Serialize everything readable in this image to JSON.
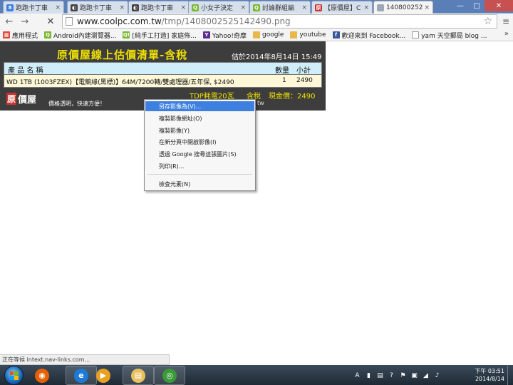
{
  "tabs": [
    {
      "label": "跑跑卡丁車",
      "favicon": "badge-8-icon",
      "color": "#3d7edb",
      "glyph": "8",
      "active": false
    },
    {
      "label": "跑跑卡丁車",
      "favicon": "gamer-icon",
      "color": "#444444",
      "glyph": "◐",
      "active": false
    },
    {
      "label": "跑跑卡丁車",
      "favicon": "gamer-icon",
      "color": "#444444",
      "glyph": "◐",
      "active": false
    },
    {
      "label": "小女子決定",
      "favicon": "q-icon",
      "color": "#7ab832",
      "glyph": "Q",
      "active": false
    },
    {
      "label": "討論群組編",
      "favicon": "q-icon",
      "color": "#7ab832",
      "glyph": "Q",
      "active": false
    },
    {
      "label": "【原價屋】C",
      "favicon": "coolpc-icon",
      "color": "#c8322f",
      "glyph": "原",
      "active": false
    },
    {
      "label": "140800252",
      "favicon": "page-icon",
      "color": "#9aa8b8",
      "glyph": "",
      "active": true
    }
  ],
  "window": {
    "minimize": "—",
    "maximize": "□",
    "close": "✕"
  },
  "toolbar": {
    "back": "←",
    "reload": "✕",
    "forward": "→"
  },
  "address": {
    "host": "www.coolpc.com.tw",
    "path": "/tmp/1408002525142490.png"
  },
  "bookmarks": [
    {
      "label": "應用程式",
      "icon": "apps-grid-icon",
      "color": "#e04a3a",
      "glyph": "▦"
    },
    {
      "label": "Android內建瀏覽器...",
      "icon": "q-icon",
      "color": "#7ab832",
      "glyph": "Q"
    },
    {
      "label": "[純手工打造] 家庭佈...",
      "icon": "q-icon",
      "color": "#7ab832",
      "glyph": "Q!"
    },
    {
      "label": "Yahoo!奇摩",
      "icon": "yahoo-icon",
      "color": "#5b2e91",
      "glyph": "Y"
    },
    {
      "label": "google",
      "icon": "folder-icon",
      "color": "#e8b84a",
      "glyph": ""
    },
    {
      "label": "youtube",
      "icon": "folder-icon",
      "color": "#e8b84a",
      "glyph": ""
    },
    {
      "label": "歡迎來到 Facebook...",
      "icon": "facebook-icon",
      "color": "#3b5998",
      "glyph": "f"
    },
    {
      "label": "yam 天空郵局 blog ...",
      "icon": "page-icon",
      "color": "#ffffff",
      "glyph": ""
    }
  ],
  "bookmarks_more": "»",
  "quote": {
    "title": "原價屋線上估價清單-含稅",
    "date": "估於2014年8月14日 15:49",
    "header": {
      "name": "產 品 名 稱",
      "qty": "數量",
      "subtotal": "小計"
    },
    "rows": [
      {
        "name": "WD 1TB (1003FZEX)【電競綠(黑標)】64M/7200轉/雙處理器/五年保, $2490",
        "qty": "1",
        "subtotal": "2490"
      }
    ],
    "tdp": "TDP耗電20瓦",
    "tax": "含稅",
    "total": "現金價：2490",
    "logo_mark": "原",
    "logo_rest": "價屋",
    "slogan": "價格透明，快速方便！",
    "slogan_red": "",
    "site": "tw"
  },
  "context_menu": {
    "items": [
      {
        "label": "另存影像為(V)...",
        "highlighted": true
      },
      {
        "label": "複製影像網址(O)",
        "highlighted": false
      },
      {
        "label": "複製影像(Y)",
        "highlighted": false
      },
      {
        "label": "在新分頁中開啟影像(I)",
        "highlighted": false
      },
      {
        "label": "透過 Google 搜尋這張圖片(S)",
        "highlighted": false
      },
      {
        "label": "列印(R)...",
        "highlighted": false
      },
      {
        "label": "檢查元素(N)",
        "highlighted": false
      }
    ]
  },
  "status": "正在等候 intext.nav-links.com...",
  "taskbar": {
    "apps": [
      {
        "name": "firefox",
        "icon": "firefox-icon",
        "color": "#e66000",
        "glyph": "◉",
        "open": false
      },
      {
        "name": "internet-explorer",
        "icon": "ie-icon",
        "color": "#1d7ad6",
        "glyph": "e",
        "open": true
      },
      {
        "name": "media-player",
        "icon": "media-player-icon",
        "color": "#e8a020",
        "glyph": "▶",
        "open": false
      },
      {
        "name": "explorer",
        "icon": "folder-icon",
        "color": "#e8c060",
        "glyph": "▤",
        "open": true
      },
      {
        "name": "chrome",
        "icon": "chrome-icon",
        "color": "#3a9a3a",
        "glyph": "◎",
        "open": true
      }
    ],
    "tray": [
      "A",
      "▮",
      "▤",
      "?",
      "⚑",
      "▣",
      "◢",
      "♪"
    ],
    "clock_time": "下午 03:51",
    "clock_date": "2014/8/14"
  }
}
